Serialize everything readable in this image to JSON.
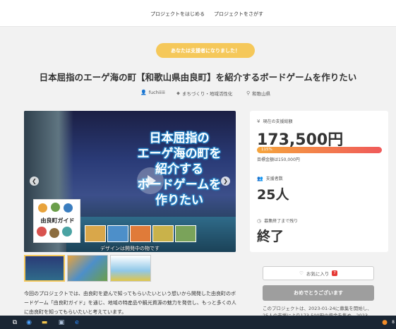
{
  "nav": {
    "start_project": "プロジェクトをはじめる",
    "find_project": "プロジェクトをさがす"
  },
  "status_badge": "あなたは支援者になりました！",
  "title": "日本屈指のエーゲ海の町【和歌山県由良町】を紹介するボードゲームを作りたい",
  "meta": {
    "author": "fuchiiiii",
    "category": "まちづくり・地域活性化",
    "location": "和歌山県"
  },
  "hero": {
    "headline_lines": [
      "日本屈指の",
      "エーゲ海の町を",
      "紹介する",
      "ボードゲームを",
      "作りたい"
    ],
    "guide_title": "由良町ガイド",
    "caption": "デザインは開発中の物です"
  },
  "stats": {
    "raised_label": "現在の支援総額",
    "raised_value": "173,500円",
    "progress_percent_label": "115%",
    "progress_fraction": 1.0,
    "goal_text": "目標金額は150,000円",
    "backers_label": "支援者数",
    "backers_value": "25人",
    "remaining_label": "募集終了まで残り",
    "remaining_value": "終了"
  },
  "favorite": {
    "label": "お気に入り",
    "count": "7"
  },
  "congrats_button": "おめでとうございます",
  "closing_note": "このプロジェクトは、2023-01-24に募集を開始し、25人の支援により173,500円の資金を集め、2023-02-",
  "description": "今回のプロジェクトでは、由良町を遊んで知ってもらいたいという想いから開発した由良町のボードゲーム「由良町ガイド」を通じ、地域の特産品や観光資源の魅力を発信し、もっと多くの人に由良町を知ってもらいたいと考えています。",
  "colors": {
    "accent": "#f5c85a",
    "progress_start": "#f5a53d",
    "progress_end": "#f05a5a",
    "button_disabled": "#9e9e9e"
  },
  "icons": {
    "author": "person-icon",
    "category": "tag-icon",
    "location": "pin-icon",
    "raised": "yen-icon",
    "backers": "people-icon",
    "remaining": "clock-icon",
    "favorite": "heart-icon"
  },
  "taskbar": {
    "tray_value": "8"
  }
}
